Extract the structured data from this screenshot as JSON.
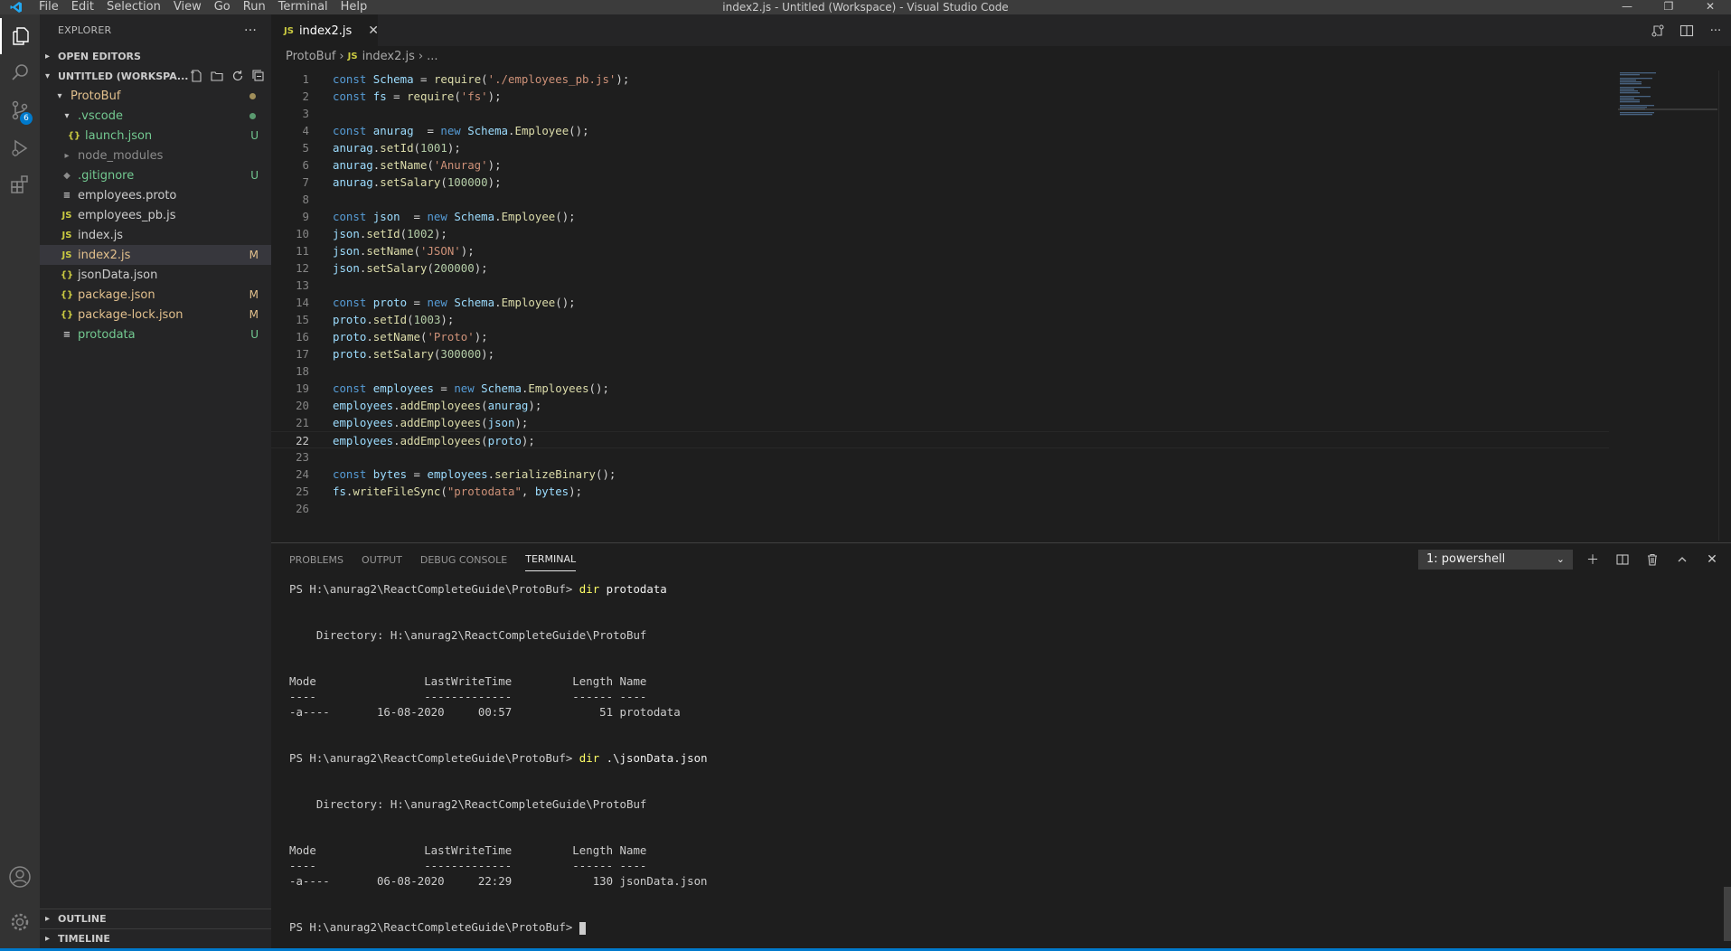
{
  "titlebar": {
    "title": "index2.js - Untitled (Workspace) - Visual Studio Code",
    "menu": [
      "File",
      "Edit",
      "Selection",
      "View",
      "Go",
      "Run",
      "Terminal",
      "Help"
    ]
  },
  "activity": {
    "scm_badge": "6"
  },
  "sidebar": {
    "title": "EXPLORER",
    "more": "···",
    "open_editors": "OPEN EDITORS",
    "workspace": "UNTITLED (WORKSPA...",
    "outline": "OUTLINE",
    "timeline": "TIMELINE",
    "tree": [
      {
        "label": "ProtoBuf",
        "icon": "›",
        "deco": ""
      },
      {
        "label": ".vscode",
        "icon": "›",
        "deco": ""
      },
      {
        "label": "launch.json",
        "icon": "{}",
        "deco": "U"
      },
      {
        "label": "node_modules",
        "icon": "›",
        "deco": ""
      },
      {
        "label": ".gitignore",
        "icon": "◆",
        "deco": "U"
      },
      {
        "label": "employees.proto",
        "icon": "≡",
        "deco": ""
      },
      {
        "label": "employees_pb.js",
        "icon": "JS",
        "deco": ""
      },
      {
        "label": "index.js",
        "icon": "JS",
        "deco": ""
      },
      {
        "label": "index2.js",
        "icon": "JS",
        "deco": "M"
      },
      {
        "label": "jsonData.json",
        "icon": "{}",
        "deco": ""
      },
      {
        "label": "package.json",
        "icon": "{}",
        "deco": "M"
      },
      {
        "label": "package-lock.json",
        "icon": "{}",
        "deco": "M"
      },
      {
        "label": "protodata",
        "icon": "≡",
        "deco": "U"
      }
    ]
  },
  "editor": {
    "tab_label": "index2.js",
    "tab_icon": "JS",
    "breadcrumb": {
      "folder": "ProtoBuf",
      "file": "index2.js",
      "tail": "..."
    },
    "code": [
      "const Schema = require('./employees_pb.js');",
      "const fs = require('fs');",
      "",
      "const anurag  = new Schema.Employee();",
      "anurag.setId(1001);",
      "anurag.setName('Anurag');",
      "anurag.setSalary(100000);",
      "",
      "const json  = new Schema.Employee();",
      "json.setId(1002);",
      "json.setName('JSON');",
      "json.setSalary(200000);",
      "",
      "const proto = new Schema.Employee();",
      "proto.setId(1003);",
      "proto.setName('Proto');",
      "proto.setSalary(300000);",
      "",
      "const employees = new Schema.Employees();",
      "employees.addEmployees(anurag);",
      "employees.addEmployees(json);",
      "employees.addEmployees(proto);",
      "",
      "const bytes = employees.serializeBinary();",
      "fs.writeFileSync(\"protodata\", bytes);",
      ""
    ],
    "current_line": 22
  },
  "panel": {
    "tabs": [
      "PROBLEMS",
      "OUTPUT",
      "DEBUG CONSOLE",
      "TERMINAL"
    ],
    "active_tab": "TERMINAL",
    "terminal_select": "1: powershell",
    "terminal": [
      {
        "text": "PS H:\\anurag2\\ReactCompleteGuide\\ProtoBuf> ",
        "cmd": "dir",
        "arg": " protodata"
      },
      {
        "text": ""
      },
      {
        "text": ""
      },
      {
        "text": "    Directory: H:\\anurag2\\ReactCompleteGuide\\ProtoBuf"
      },
      {
        "text": ""
      },
      {
        "text": ""
      },
      {
        "text": "Mode                LastWriteTime         Length Name"
      },
      {
        "text": "----                -------------         ------ ----"
      },
      {
        "text": "-a----       16-08-2020     00:57             51 protodata"
      },
      {
        "text": ""
      },
      {
        "text": ""
      },
      {
        "text": "PS H:\\anurag2\\ReactCompleteGuide\\ProtoBuf> ",
        "cmd": "dir",
        "arg": " .\\jsonData.json"
      },
      {
        "text": ""
      },
      {
        "text": ""
      },
      {
        "text": "    Directory: H:\\anurag2\\ReactCompleteGuide\\ProtoBuf"
      },
      {
        "text": ""
      },
      {
        "text": ""
      },
      {
        "text": "Mode                LastWriteTime         Length Name"
      },
      {
        "text": "----                -------------         ------ ----"
      },
      {
        "text": "-a----       06-08-2020     22:29            130 jsonData.json"
      },
      {
        "text": ""
      },
      {
        "text": ""
      },
      {
        "text": "PS H:\\anurag2\\ReactCompleteGuide\\ProtoBuf> ",
        "cursor": true
      }
    ]
  },
  "colors": {
    "accent": "#007acc",
    "untracked": "#73c991",
    "modified": "#e2c08d",
    "js_icon": "#cbcb41"
  }
}
